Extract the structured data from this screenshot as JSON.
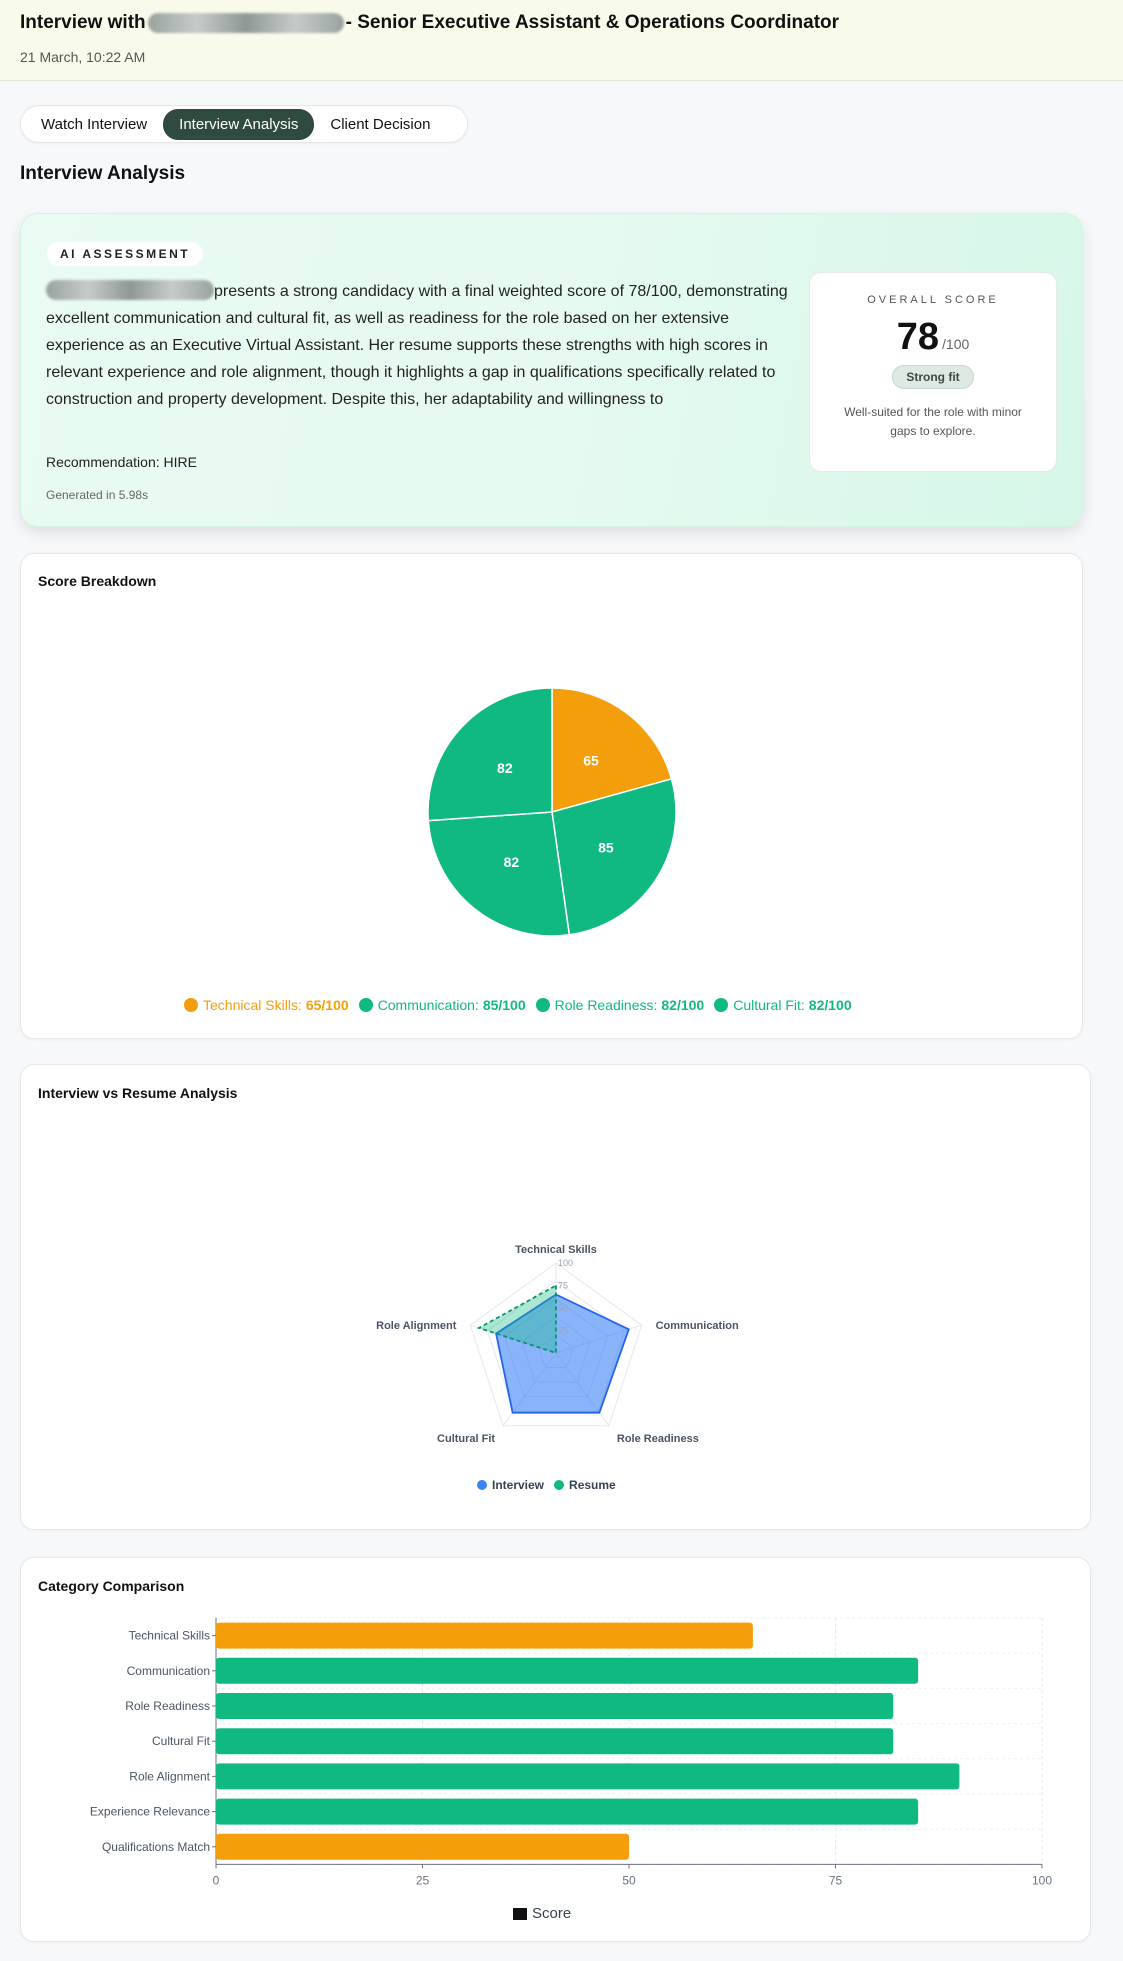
{
  "header": {
    "title_prefix": "Interview with",
    "title_suffix": "- Senior Executive Assistant & Operations Coordinator",
    "date": "21 March, 10:22 AM"
  },
  "tabs": [
    {
      "label": "Watch Interview",
      "active": false
    },
    {
      "label": "Interview Analysis",
      "active": true
    },
    {
      "label": "Client Decision",
      "active": false
    }
  ],
  "section_title": "Interview Analysis",
  "ai_assessment": {
    "badge": "AI ASSESSMENT",
    "text": "presents a strong candidacy with a final weighted score of 78/100, demonstrating excellent communication and cultural fit, as well as readiness for the role based on her extensive experience as an Executive Virtual Assistant. Her resume supports these strengths with high scores in relevant experience and role alignment, though it highlights a gap in qualifications specifically related to construction and property development. Despite this, her adaptability and willingness to",
    "recommendation": "Recommendation: HIRE",
    "generated": "Generated in 5.98s",
    "overall_label": "OVERALL SCORE",
    "overall_score": "78",
    "overall_max": "/100",
    "fit_badge": "Strong fit",
    "fit_description": "Well-suited for the role with minor gaps to explore."
  },
  "colors": {
    "orange": "#f59e0b",
    "green": "#10b981",
    "blue": "#3b82f6",
    "accent_dark": "#2f4a3f"
  },
  "score_breakdown": {
    "title": "Score Breakdown"
  },
  "radar": {
    "title": "Interview vs Resume Analysis"
  },
  "bars": {
    "title": "Category Comparison"
  },
  "chart_data": [
    {
      "type": "pie",
      "categories": [
        "Technical Skills",
        "Communication",
        "Role Readiness",
        "Cultural Fit"
      ],
      "values": [
        65,
        85,
        82,
        82
      ],
      "legend_labels": [
        "Technical Skills:",
        "Communication:",
        "Role Readiness:",
        "Cultural Fit:"
      ],
      "legend_values": [
        "65/100",
        "85/100",
        "82/100",
        "82/100"
      ],
      "colors": [
        "#f59e0b",
        "#10b981",
        "#10b981",
        "#10b981"
      ],
      "legend": "bottom"
    },
    {
      "type": "radar",
      "axes": [
        "Technical Skills",
        "Communication",
        "Role Readiness",
        "Cultural Fit",
        "Role Alignment"
      ],
      "ticks": [
        "25",
        "50",
        "75",
        "100"
      ],
      "rlim": [
        0,
        100
      ],
      "series": [
        {
          "name": "Interview",
          "values": [
            65,
            85,
            82,
            82,
            70
          ],
          "color": "#3b82f6"
        },
        {
          "name": "Resume",
          "values": [
            75,
            0,
            0,
            0,
            90
          ],
          "color": "#10b981"
        }
      ],
      "legend": "bottom"
    },
    {
      "type": "bar",
      "orientation": "horizontal",
      "categories": [
        "Technical Skills",
        "Communication",
        "Role Readiness",
        "Cultural Fit",
        "Role Alignment",
        "Experience Relevance",
        "Qualifications Match"
      ],
      "values": [
        65,
        85,
        82,
        82,
        90,
        85,
        50
      ],
      "colors": [
        "#f59e0b",
        "#10b981",
        "#10b981",
        "#10b981",
        "#10b981",
        "#10b981",
        "#f59e0b"
      ],
      "xticks": [
        "0",
        "25",
        "50",
        "75",
        "100"
      ],
      "xlim": [
        0,
        100
      ],
      "series_name": "Score",
      "grid": true,
      "legend": "bottom"
    }
  ]
}
